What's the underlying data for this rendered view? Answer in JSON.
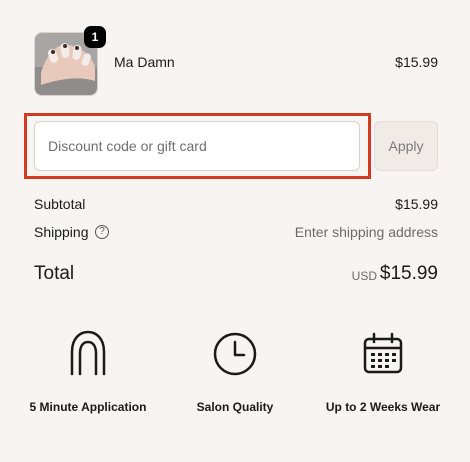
{
  "line_item": {
    "quantity": "1",
    "name": "Ma Damn",
    "price": "$15.99",
    "image_icon": "nail-product-image"
  },
  "discount": {
    "placeholder": "Discount code or gift card",
    "value": "",
    "apply_label": "Apply",
    "highlight_color": "#d33a22"
  },
  "summary": {
    "subtotal_label": "Subtotal",
    "subtotal_value": "$15.99",
    "shipping_label": "Shipping",
    "shipping_help_icon": "question-circle-icon",
    "shipping_value": "Enter shipping address",
    "total_label": "Total",
    "currency": "USD",
    "total_value": "$15.99"
  },
  "features": [
    {
      "icon": "nail-icon",
      "text": "5 Minute Application"
    },
    {
      "icon": "clock-icon",
      "text": "Salon Quality"
    },
    {
      "icon": "calendar-icon",
      "text": "Up to 2 Weeks Wear"
    }
  ],
  "colors": {
    "background": "#f8f4f1",
    "accent_border": "#d33a22",
    "badge": "#000000"
  }
}
